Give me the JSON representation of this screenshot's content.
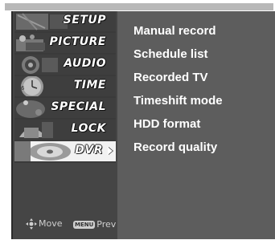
{
  "sidebar": {
    "items": [
      {
        "label": "SETUP",
        "selected": false
      },
      {
        "label": "PICTURE",
        "selected": false
      },
      {
        "label": "AUDIO",
        "selected": false
      },
      {
        "label": "TIME",
        "selected": false
      },
      {
        "label": "SPECIAL",
        "selected": false
      },
      {
        "label": "LOCK",
        "selected": false
      },
      {
        "label": "DVR",
        "selected": true
      }
    ]
  },
  "content": {
    "items": [
      {
        "label": "Manual record"
      },
      {
        "label": "Schedule list"
      },
      {
        "label": "Recorded TV"
      },
      {
        "label": "Timeshift mode"
      },
      {
        "label": "HDD format"
      },
      {
        "label": "Record quality"
      }
    ]
  },
  "hints": {
    "move_label": "Move",
    "menu_button_label": "MENU",
    "prev_label": "Prev"
  }
}
